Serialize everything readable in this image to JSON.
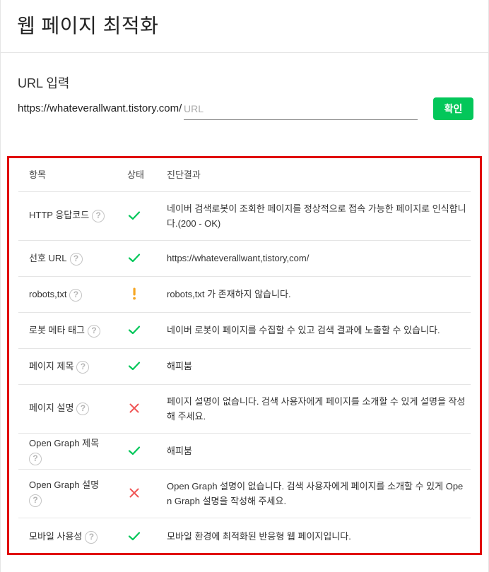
{
  "page": {
    "title": "웹 페이지 최적화"
  },
  "url_section": {
    "label": "URL 입력",
    "prefix": "https://whateverallwant.tistory.com/",
    "input_value": "",
    "placeholder": "URL",
    "confirm_label": "확인"
  },
  "table": {
    "headers": {
      "item": "항목",
      "status": "상태",
      "result": "진단결과"
    },
    "rows": [
      {
        "item": "HTTP 응답코드",
        "status": "ok",
        "result": "네이버 검색로봇이 조회한 페이지를 정상적으로 접속 가능한 페이지로 인식합니다.(200 - OK)"
      },
      {
        "item": "선호 URL",
        "status": "ok",
        "result": "https://whateverallwant,tistory,com/"
      },
      {
        "item": "robots,txt",
        "status": "warn",
        "result": "robots,txt 가 존재하지 않습니다."
      },
      {
        "item": "로봇 메타 태그",
        "status": "ok",
        "result": "네이버 로봇이 페이지를 수집할 수 있고 검색 결과에 노출할 수 있습니다."
      },
      {
        "item": "페이지 제목",
        "status": "ok",
        "result": "해피붐"
      },
      {
        "item": "페이지 설명",
        "status": "fail",
        "result": "페이지 설명이 없습니다. 검색 사용자에게 페이지를 소개할 수 있게 설명을 작성해 주세요."
      },
      {
        "item": "Open Graph 제목",
        "status": "ok",
        "result": "해피붐"
      },
      {
        "item": "Open Graph 설명",
        "status": "fail",
        "result": "Open Graph 설명이 없습니다. 검색 사용자에게 페이지를 소개할 수 있게 Open Graph 설명을 작성해 주세요."
      },
      {
        "item": "모바일 사용성",
        "status": "ok",
        "result": "모바일 환경에 최적화된 반응형 웹 페이지입니다."
      }
    ]
  },
  "help_icon_glyph": "?",
  "colors": {
    "ok": "#03c75a",
    "warn": "#f5a623",
    "fail": "#f05656",
    "highlight_border": "#e00000",
    "button": "#03c75a"
  },
  "icons": {
    "ok": "check-icon",
    "warn": "exclamation-icon",
    "fail": "x-icon",
    "help": "question-circle-icon"
  }
}
